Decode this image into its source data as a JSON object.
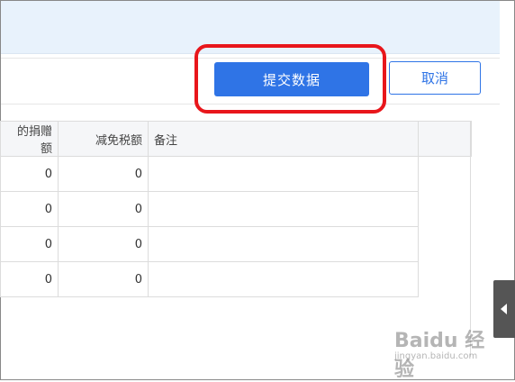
{
  "actions": {
    "submit_label": "提交数据",
    "cancel_label": "取消"
  },
  "table": {
    "headers": [
      "的捐赠额",
      "减免税额",
      "备注",
      ""
    ],
    "rows": [
      [
        "0",
        "0",
        ""
      ],
      [
        "0",
        "0",
        ""
      ],
      [
        "0",
        "0",
        ""
      ],
      [
        "0",
        "0",
        ""
      ]
    ]
  },
  "watermark": {
    "logo_text": "Baidu 经验",
    "url_text": "jingyan.baidu.com"
  },
  "colors": {
    "primary": "#2f74e6",
    "highlight": "#e8161b",
    "banner": "#e8f2fc"
  },
  "icons": {
    "side_tab": "caret-left-icon"
  }
}
